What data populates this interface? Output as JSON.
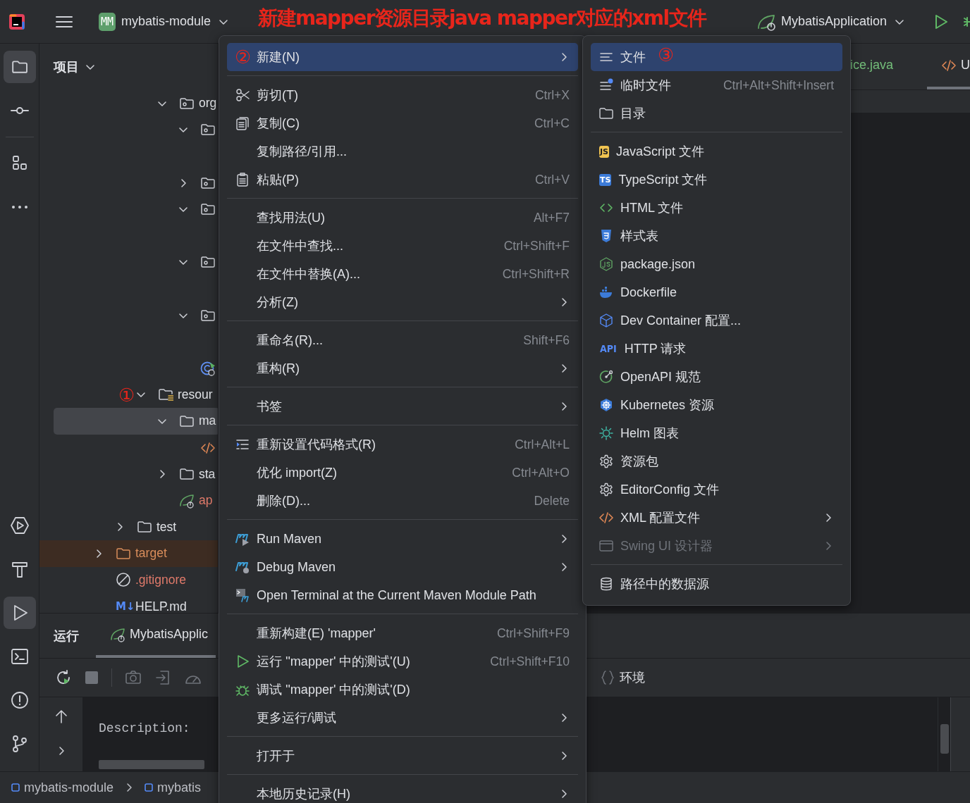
{
  "top_bar": {
    "project_badge": "MM",
    "project": "mybatis-module",
    "run_config": "MybatisApplication"
  },
  "annotations": {
    "title": "新建mapper资源目录java mapper对应的xml文件",
    "steps": [
      "①",
      "②",
      "③"
    ]
  },
  "tool_strip": {
    "top": [
      {
        "selected": true
      },
      {
        "selected": false
      },
      {
        "selected": false
      },
      {
        "selected": false
      }
    ],
    "bottom": [
      {
        "selected": false
      },
      {
        "selected": false
      },
      {
        "selected": true
      },
      {
        "selected": false
      },
      {
        "selected": false
      },
      {
        "selected": false
      }
    ]
  },
  "project_panel": {
    "title": "项目",
    "tree": [
      {
        "kind": "offscreen",
        "children": [
          {
            "kind": "offscreen",
            "children": [
              {
                "kind": "offscreen",
                "children": [
                  {
                    "kind": "package",
                    "label": "org",
                    "selected": false,
                    "expanded": true,
                    "untracked": false,
                    "children": [
                      {
                        "kind": "package",
                        "selected": false,
                        "expanded": true,
                        "children": [
                          {
                            "kind": "covered"
                          }
                        ]
                      },
                      {
                        "kind": "package",
                        "selected": false,
                        "expanded": false
                      },
                      {
                        "kind": "package",
                        "selected": false,
                        "expanded": true,
                        "children": [
                          {
                            "kind": "covered"
                          }
                        ]
                      },
                      {
                        "kind": "package",
                        "selected": false,
                        "expanded": true,
                        "children": [
                          {
                            "kind": "covered"
                          }
                        ]
                      },
                      {
                        "kind": "package",
                        "selected": false,
                        "expanded": true,
                        "children": [
                          {
                            "kind": "covered"
                          }
                        ]
                      },
                      {
                        "kind": "spring-app",
                        "selected": false
                      }
                    ]
                  }
                ]
              },
              {
                "kind": "resource-root",
                "label": "resour",
                "selected": false,
                "expanded": true,
                "untracked": false,
                "children": [
                  {
                    "kind": "folder",
                    "label": "ma",
                    "selected": true,
                    "expanded": true,
                    "untracked": false,
                    "children": [
                      {
                        "kind": "xml-file",
                        "selected": false
                      }
                    ]
                  },
                  {
                    "kind": "folder",
                    "label": "sta",
                    "selected": false,
                    "expanded": false,
                    "untracked": false
                  },
                  {
                    "kind": "spring-config",
                    "label": "ap",
                    "selected": false,
                    "untracked": true
                  }
                ]
              }
            ]
          },
          {
            "kind": "folder",
            "label": "test",
            "selected": false,
            "expanded": false,
            "untracked": false
          }
        ]
      },
      {
        "kind": "excluded-folder",
        "label": "target",
        "selected": false,
        "expanded": false,
        "untracked": false
      },
      {
        "kind": "ignore-file",
        "label": ".gitignore",
        "selected": false,
        "untracked": true
      },
      {
        "kind": "markdown-file",
        "badge": "M↓",
        "label": "HELP.md",
        "selected": false,
        "untracked": false
      }
    ]
  },
  "editor": {
    "tabs": [
      {
        "label": "ice.java",
        "selected": false,
        "added": true
      },
      {
        "label": "U",
        "selected": true,
        "added": false
      }
    ]
  },
  "run_panel": {
    "title": "运行",
    "tab": {
      "label": "MybatisApplic",
      "selected": true
    },
    "env_label": "环境",
    "console": [
      "Description:"
    ]
  },
  "status_bar": {
    "breadcrumbs": [
      "mybatis-module",
      "mybatis"
    ]
  },
  "context_menu": {
    "items": [
      {
        "kind": "item",
        "label": "新建(N)",
        "submenu": true,
        "selected": true
      },
      {
        "kind": "separator"
      },
      {
        "kind": "item",
        "label": "剪切(T)",
        "shortcut": "Ctrl+X",
        "submenu": false,
        "selected": false
      },
      {
        "kind": "item",
        "label": "复制(C)",
        "shortcut": "Ctrl+C",
        "submenu": false,
        "selected": false
      },
      {
        "kind": "item",
        "label": "复制路径/引用...",
        "submenu": false,
        "selected": false
      },
      {
        "kind": "item",
        "label": "粘贴(P)",
        "shortcut": "Ctrl+V",
        "submenu": false,
        "selected": false
      },
      {
        "kind": "separator"
      },
      {
        "kind": "item",
        "label": "查找用法(U)",
        "shortcut": "Alt+F7",
        "submenu": false,
        "selected": false
      },
      {
        "kind": "item",
        "label": "在文件中查找...",
        "shortcut": "Ctrl+Shift+F",
        "submenu": false,
        "selected": false
      },
      {
        "kind": "item",
        "label": "在文件中替换(A)...",
        "shortcut": "Ctrl+Shift+R",
        "submenu": false,
        "selected": false
      },
      {
        "kind": "item",
        "label": "分析(Z)",
        "submenu": true,
        "selected": false
      },
      {
        "kind": "separator"
      },
      {
        "kind": "item",
        "label": "重命名(R)...",
        "shortcut": "Shift+F6",
        "submenu": false,
        "selected": false
      },
      {
        "kind": "item",
        "label": "重构(R)",
        "submenu": true,
        "selected": false
      },
      {
        "kind": "separator"
      },
      {
        "kind": "item",
        "label": "书签",
        "submenu": true,
        "selected": false
      },
      {
        "kind": "separator"
      },
      {
        "kind": "item",
        "label": "重新设置代码格式(R)",
        "shortcut": "Ctrl+Alt+L",
        "submenu": false,
        "selected": false
      },
      {
        "kind": "item",
        "label": "优化 import(Z)",
        "shortcut": "Ctrl+Alt+O",
        "submenu": false,
        "selected": false
      },
      {
        "kind": "item",
        "label": "删除(D)...",
        "shortcut": "Delete",
        "submenu": false,
        "selected": false
      },
      {
        "kind": "separator"
      },
      {
        "kind": "item",
        "label": "Run Maven",
        "submenu": true,
        "selected": false
      },
      {
        "kind": "item",
        "label": "Debug Maven",
        "submenu": true,
        "selected": false
      },
      {
        "kind": "item",
        "label": "Open Terminal at the Current Maven Module Path",
        "submenu": false,
        "selected": false
      },
      {
        "kind": "separator"
      },
      {
        "kind": "item",
        "label": "重新构建(E) 'mapper'",
        "shortcut": "Ctrl+Shift+F9",
        "submenu": false,
        "selected": false
      },
      {
        "kind": "item",
        "label": "运行 ''mapper' 中的测试'(U)",
        "shortcut": "Ctrl+Shift+F10",
        "submenu": false,
        "selected": false
      },
      {
        "kind": "item",
        "label": "调试 ''mapper' 中的测试'(D)",
        "submenu": false,
        "selected": false
      },
      {
        "kind": "item",
        "label": "更多运行/调试",
        "submenu": true,
        "selected": false
      },
      {
        "kind": "separator"
      },
      {
        "kind": "item",
        "label": "打开于",
        "submenu": true,
        "selected": false
      },
      {
        "kind": "separator"
      },
      {
        "kind": "item",
        "label": "本地历史记录(H)",
        "submenu": true,
        "selected": false
      }
    ]
  },
  "new_submenu": {
    "items": [
      {
        "kind": "item",
        "label": "文件",
        "submenu": false,
        "selected": true,
        "disabled": false
      },
      {
        "kind": "item",
        "label": "临时文件",
        "shortcut": "Ctrl+Alt+Shift+Insert",
        "submenu": false,
        "selected": false,
        "disabled": false
      },
      {
        "kind": "item",
        "label": "目录",
        "submenu": false,
        "selected": false,
        "disabled": false
      },
      {
        "kind": "separator"
      },
      {
        "kind": "item",
        "badge": "JS",
        "label": "JavaScript 文件",
        "submenu": false,
        "selected": false,
        "disabled": false
      },
      {
        "kind": "item",
        "badge": "TS",
        "label": "TypeScript 文件",
        "submenu": false,
        "selected": false,
        "disabled": false
      },
      {
        "kind": "item",
        "label": "HTML 文件",
        "submenu": false,
        "selected": false,
        "disabled": false
      },
      {
        "kind": "item",
        "label": "样式表",
        "submenu": false,
        "selected": false,
        "disabled": false
      },
      {
        "kind": "item",
        "label": "package.json",
        "submenu": false,
        "selected": false,
        "disabled": false
      },
      {
        "kind": "item",
        "label": "Dockerfile",
        "submenu": false,
        "selected": false,
        "disabled": false
      },
      {
        "kind": "item",
        "label": "Dev Container 配置...",
        "submenu": false,
        "selected": false,
        "disabled": false
      },
      {
        "kind": "item",
        "badge": "API",
        "label": "HTTP 请求",
        "submenu": false,
        "selected": false,
        "disabled": false
      },
      {
        "kind": "item",
        "label": "OpenAPI 规范",
        "submenu": false,
        "selected": false,
        "disabled": false
      },
      {
        "kind": "item",
        "label": "Kubernetes 资源",
        "submenu": false,
        "selected": false,
        "disabled": false
      },
      {
        "kind": "item",
        "label": "Helm 图表",
        "submenu": false,
        "selected": false,
        "disabled": false
      },
      {
        "kind": "item",
        "label": "资源包",
        "submenu": false,
        "selected": false,
        "disabled": false
      },
      {
        "kind": "item",
        "label": "EditorConfig 文件",
        "submenu": false,
        "selected": false,
        "disabled": false
      },
      {
        "kind": "item",
        "label": "XML 配置文件",
        "submenu": true,
        "selected": false,
        "disabled": false
      },
      {
        "kind": "item",
        "label": "Swing UI 设计器",
        "submenu": true,
        "selected": false,
        "disabled": true
      },
      {
        "kind": "separator"
      },
      {
        "kind": "item",
        "label": "路径中的数据源",
        "submenu": false,
        "selected": false,
        "disabled": false
      }
    ]
  }
}
